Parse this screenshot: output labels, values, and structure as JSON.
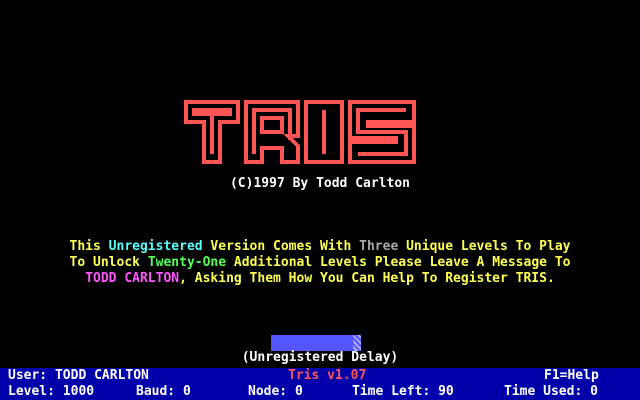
{
  "logo": {
    "text": "TRIS",
    "color": "#ff5555"
  },
  "copyright": "(C)1997 By Todd Carlton",
  "message": {
    "l1a": "This ",
    "l1b": "Unregistered",
    "l1c": " Version Comes With ",
    "l1d": "Three",
    "l1e": " Unique Levels To Play",
    "l2a": "To Unlock ",
    "l2b": "Twenty-One",
    "l2c": " Additional Levels Please Leave A Message To",
    "l3a": "TODD CARLTON",
    "l3b": ", Asking Them How You Can Help To Register TRIS."
  },
  "delay": {
    "label": "(Unregistered Delay)",
    "progress": 0.92
  },
  "status": {
    "user": "User: TODD CARLTON",
    "title": "Tris v1.07",
    "help": "F1=Help",
    "level": "Level: 1000",
    "baud": "Baud: 0",
    "node": "Node: 0",
    "time_left": "Time Left: 90",
    "time_used": "Time Used: 0"
  },
  "colors": {
    "background": "#000000",
    "logo": "#ff5555",
    "text_yellow": "#ffff55",
    "text_cyan": "#55ffff",
    "text_green": "#55ff55",
    "text_magenta": "#ff55ff",
    "status_bar": "#0000aa",
    "delay_bar": "#5555ff"
  }
}
